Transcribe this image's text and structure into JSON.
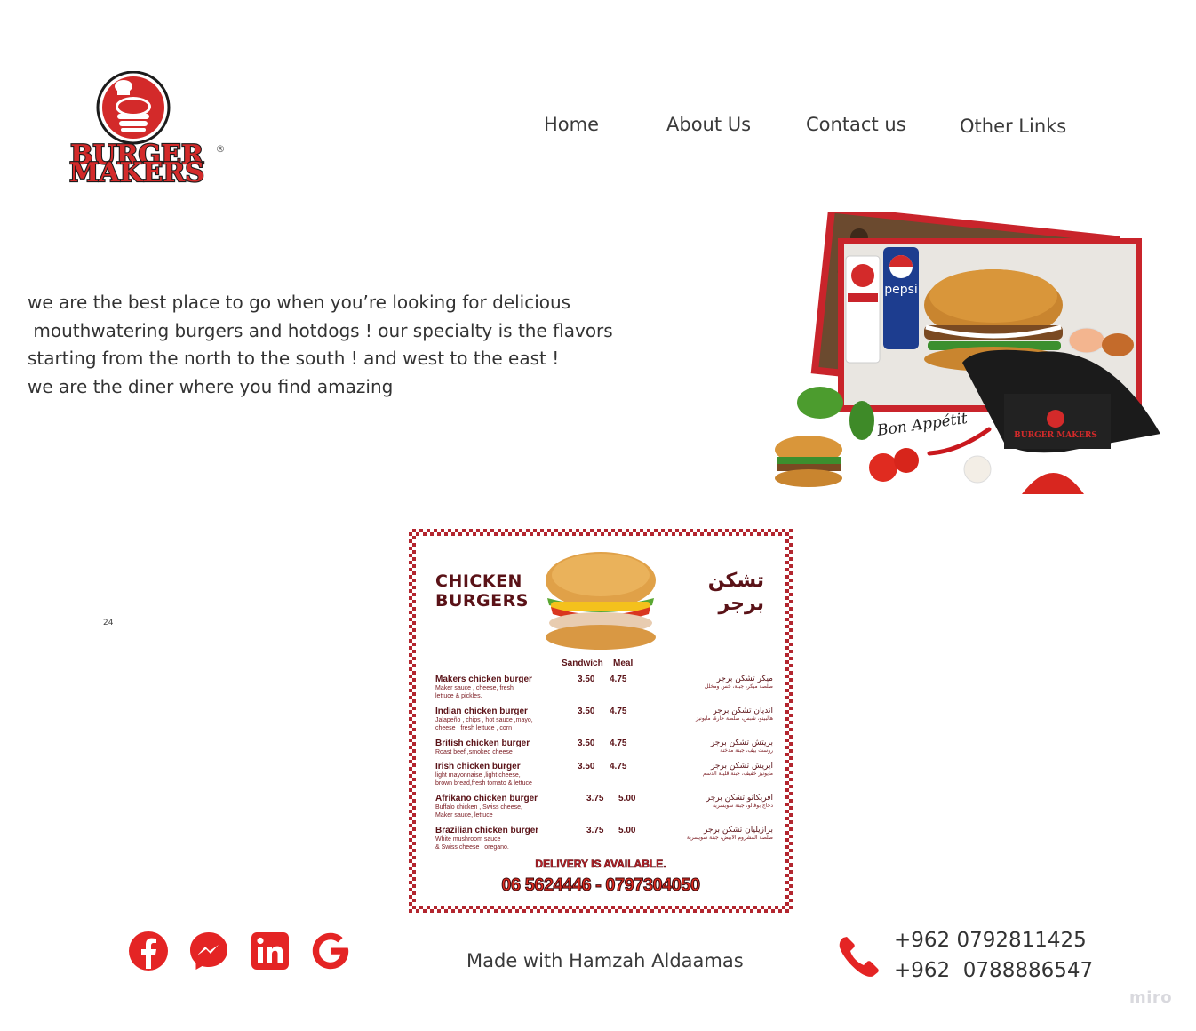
{
  "logo": {
    "line1": "BURGER",
    "line2": "MAKERS",
    "reg": "®"
  },
  "nav": {
    "items": [
      {
        "label": "Home"
      },
      {
        "label": "About Us"
      },
      {
        "label": "Contact us"
      },
      {
        "label": "Other Links"
      }
    ]
  },
  "intro": {
    "lines": [
      "we are the best place to go when you’re looking for delicious",
      " mouthwatering burgers and hotdogs ! our specialty is the flavors",
      "starting from the north to the south ! and west to the east !",
      "we are the diner where you find amazing"
    ]
  },
  "hero": {
    "can_label": "pepsi",
    "bon_text": "Bon Appétit",
    "brand_short": "BURGER MAKERS"
  },
  "page_number": "24",
  "menu": {
    "title_en_1": "CHICKEN",
    "title_en_2": "BURGERS",
    "title_ar_1": "تشكن",
    "title_ar_2": "برجر",
    "col_sandwich": "Sandwich",
    "col_meal": "Meal",
    "items": [
      {
        "name": "Makers chicken burger",
        "desc": "Maker sauce , cheese, fresh\nlettuce & pickles.",
        "sandwich": "3.50",
        "meal": "4.75",
        "ar": "ميكر تشكن برجر",
        "ar_desc": "صلصة ميكر، جبنة، خس ومخلل"
      },
      {
        "name": "Indian chicken burger",
        "desc": "Jalapeño , chips , hot sauce ,mayo,\ncheese , fresh lettuce , corn",
        "sandwich": "3.50",
        "meal": "4.75",
        "ar": "انديان تشكن برجر",
        "ar_desc": "هالبينو، شبس، صلصة حارة، مايونيز"
      },
      {
        "name": "British chicken burger",
        "desc": "Roast beef ,smoked cheese",
        "sandwich": "3.50",
        "meal": "4.75",
        "ar": "بريتش تشكن برجر",
        "ar_desc": "روست بيف، جبنة مدخنة"
      },
      {
        "name": "Irish  chicken burger",
        "desc": "light mayonnaise ,light cheese,\nbrown bread,fresh tomato & lettuce",
        "sandwich": "3.50",
        "meal": "4.75",
        "ar": "ايريش تشكن برجر",
        "ar_desc": "مايونيز خفيف، جبنة قليلة الدسم"
      },
      {
        "name": "Afrikano chicken burger",
        "desc": "Buffalo chicken , Swiss cheese,\nMaker sauce, lettuce",
        "sandwich": "3.75",
        "meal": "5.00",
        "ar": "افريكانو تشكن برجر",
        "ar_desc": "دجاج بوفالو، جبنة سويسرية"
      },
      {
        "name": "Brazilian chicken burger",
        "desc": "White mushroom sauce\n& Swiss cheese , oregano.",
        "sandwich": "3.75",
        "meal": "5.00",
        "ar": "برازيليان تشكن برجر",
        "ar_desc": "صلصة المشروم الابيض، جبنة سويسرية"
      }
    ],
    "delivery": "DELIVERY IS AVAILABLE.",
    "phones": "06 5624446 - 0797304050"
  },
  "footer": {
    "made_with": "Made with Hamzah Aldaamas",
    "phone1": "+962 0792811425",
    "phone2": "+962  0788886547",
    "social_icons": [
      "facebook-icon",
      "messenger-icon",
      "linkedin-icon",
      "google-icon"
    ],
    "watermark": "miro"
  },
  "colors": {
    "brand_red": "#d32a2a",
    "menu_maroon": "#5a1217",
    "social_red": "#e42424"
  }
}
